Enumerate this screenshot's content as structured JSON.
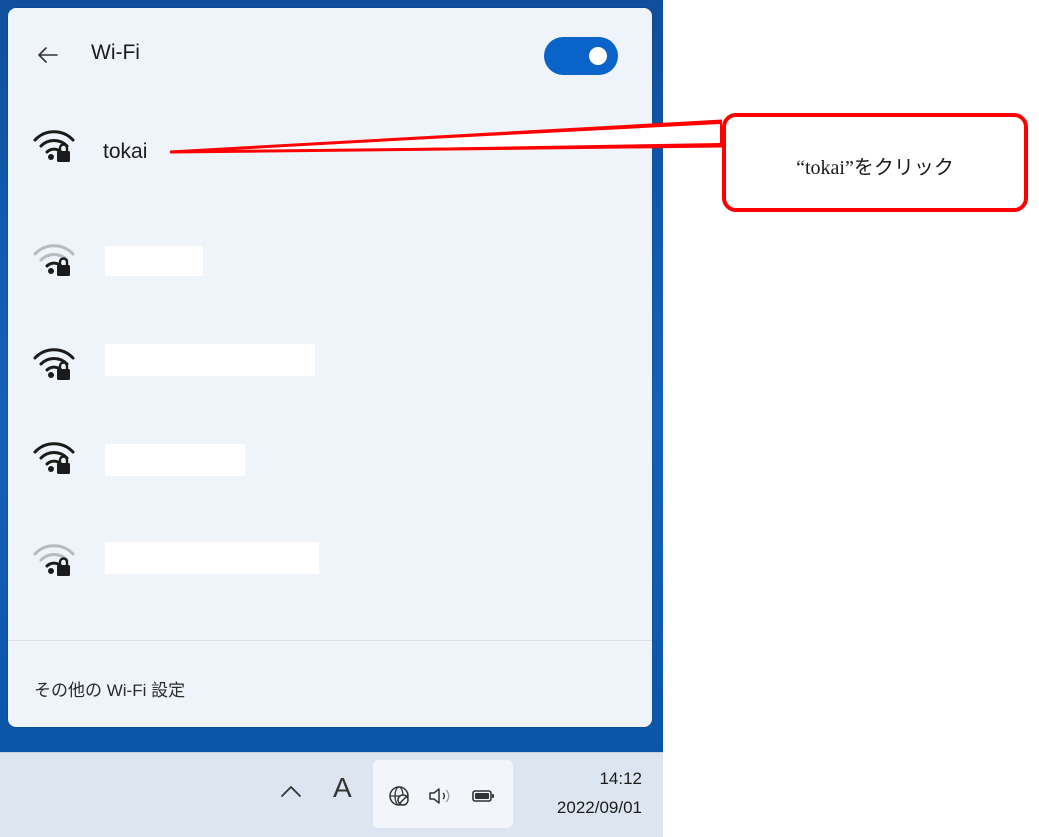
{
  "flyout": {
    "title": "Wi-Fi",
    "wifi_enabled": true,
    "back_icon": "arrow-left-icon",
    "networks": [
      {
        "name": "tokai",
        "signal": "strong",
        "secured": true
      },
      {
        "name": "",
        "signal": "weak",
        "secured": true,
        "redacted": true
      },
      {
        "name": "",
        "signal": "strong",
        "secured": true,
        "redacted": true
      },
      {
        "name": "",
        "signal": "strong",
        "secured": true,
        "redacted": true
      },
      {
        "name": "",
        "signal": "weak",
        "secured": true,
        "redacted": true
      }
    ],
    "footer_link": "その他の Wi-Fi 設定"
  },
  "taskbar": {
    "hidden_icons": "^",
    "ime": "A",
    "tray_icons": [
      "globe-no-internet-icon",
      "speaker-icon",
      "battery-icon"
    ],
    "time": "14:12",
    "date": "2022/09/01"
  },
  "annotation": {
    "text": "“tokai”をクリック",
    "color": "#ff0000"
  },
  "colors": {
    "accent": "#0a63c9",
    "panel": "#eef4f9",
    "wallpaper": "#1760b8"
  }
}
